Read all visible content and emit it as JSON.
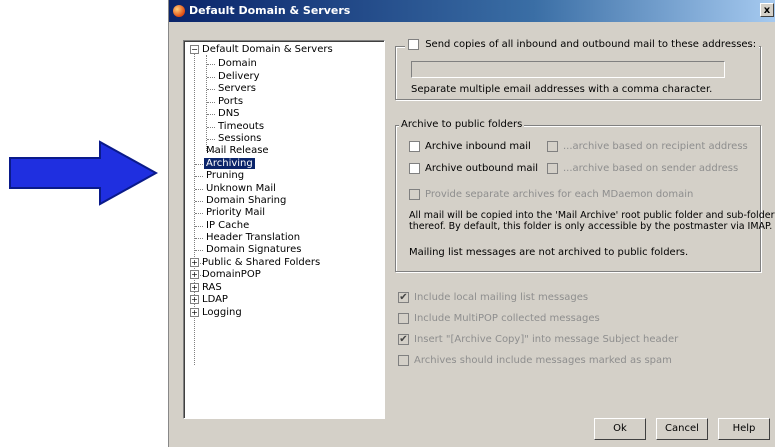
{
  "window": {
    "title": "Default Domain & Servers",
    "close_label": "x"
  },
  "tree": {
    "items": [
      {
        "label": "Default Domain & Servers",
        "expander": "−"
      },
      {
        "label": "Domain"
      },
      {
        "label": "Delivery"
      },
      {
        "label": "Servers"
      },
      {
        "label": "Ports"
      },
      {
        "label": "DNS"
      },
      {
        "label": "Timeouts"
      },
      {
        "label": "Sessions"
      },
      {
        "label": "Mail Release"
      },
      {
        "label": "Archiving"
      },
      {
        "label": "Pruning"
      },
      {
        "label": "Unknown Mail"
      },
      {
        "label": "Domain Sharing"
      },
      {
        "label": "Priority Mail"
      },
      {
        "label": "IP Cache"
      },
      {
        "label": "Header Translation"
      },
      {
        "label": "Domain Signatures"
      },
      {
        "label": "Public & Shared Folders",
        "expander": "+"
      },
      {
        "label": "DomainPOP",
        "expander": "+"
      },
      {
        "label": "RAS",
        "expander": "+"
      },
      {
        "label": "LDAP",
        "expander": "+"
      },
      {
        "label": "Logging",
        "expander": "+"
      }
    ],
    "selected": "Archiving"
  },
  "send_copies": {
    "label": "Send copies of all inbound and outbound mail to these addresses:",
    "input_value": "",
    "hint": "Separate multiple email addresses with a comma character."
  },
  "archive_public": {
    "group_label": "Archive to public folders",
    "inbound_label": "Archive inbound mail",
    "inbound_recipient_label": "...archive based on recipient address",
    "outbound_label": "Archive outbound mail",
    "outbound_sender_label": "...archive based on sender address",
    "separate_label": "Provide separate archives for each MDaemon domain",
    "info_line1": "All mail will be copied into the 'Mail Archive' root public folder and sub-folders",
    "info_line2": "thereof.  By default, this folder is only accessible by the postmaster via IMAP.",
    "mailing_note": "Mailing list messages are not archived to public folders."
  },
  "options": [
    {
      "label": "Include local mailing list messages",
      "checked": "✔"
    },
    {
      "label": "Include MultiPOP collected messages",
      "checked": ""
    },
    {
      "label": "Insert \"[Archive Copy]\" into message Subject header",
      "checked": "✔"
    },
    {
      "label": "Archives should include messages marked as spam",
      "checked": ""
    }
  ],
  "buttons": {
    "ok": "Ok",
    "cancel": "Cancel",
    "help": "Help"
  },
  "colors": {
    "arrow": "#1f2fe0",
    "selection": "#0a246a",
    "dialog": "#d4d0c8"
  }
}
